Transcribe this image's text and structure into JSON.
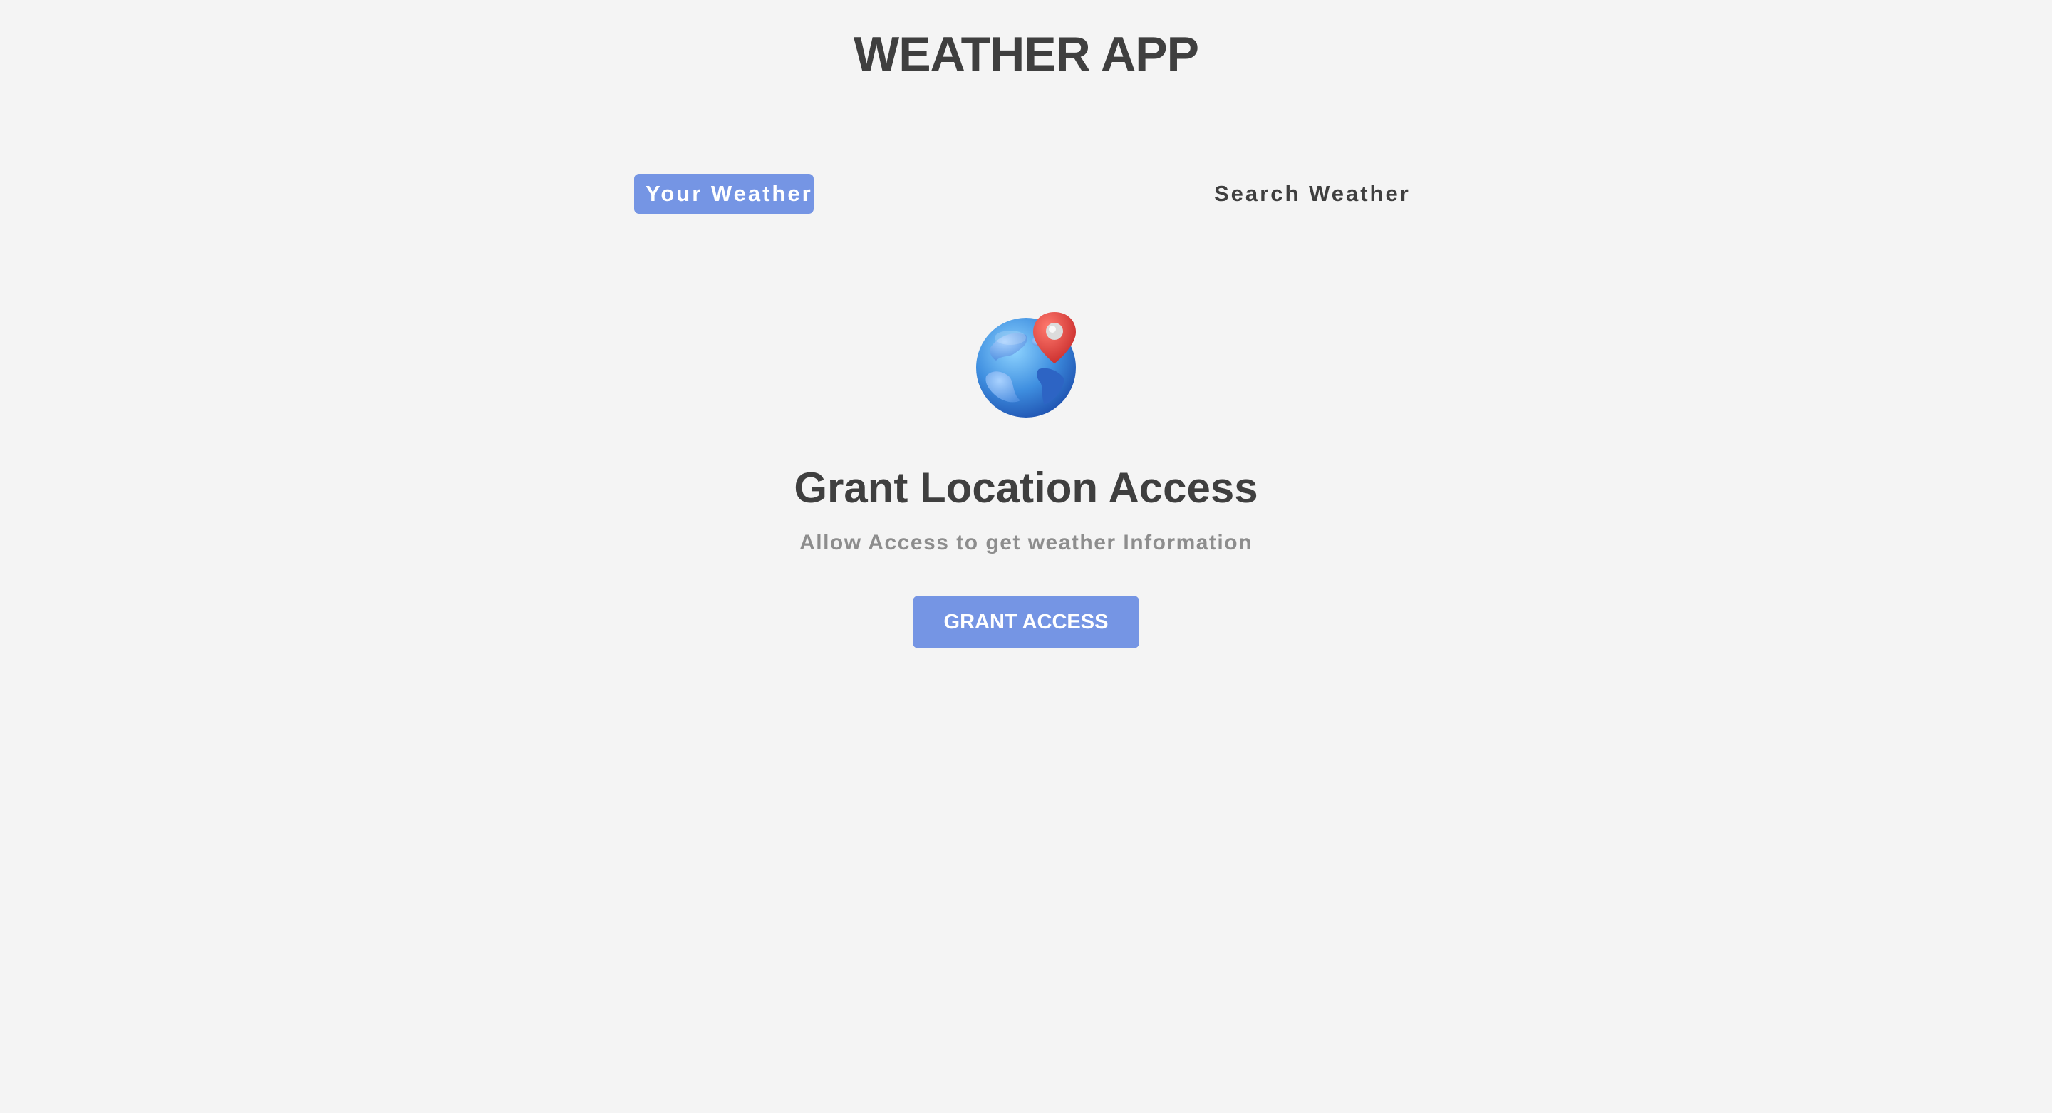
{
  "app": {
    "title": "WEATHER APP"
  },
  "tabs": [
    {
      "label": "Your Weather",
      "active": true
    },
    {
      "label": "Search Weather",
      "active": false
    }
  ],
  "grant": {
    "icon": "globe-location-icon",
    "title": "Grant Location Access",
    "subtitle": "Allow Access to get weather Information",
    "button_label": "GRANT ACCESS"
  },
  "colors": {
    "background": "#f4f4f4",
    "accent": "#7595e4",
    "heading_text": "#3f3f3f",
    "muted_text": "#8d8d8d",
    "pin_red": "#e53935"
  }
}
